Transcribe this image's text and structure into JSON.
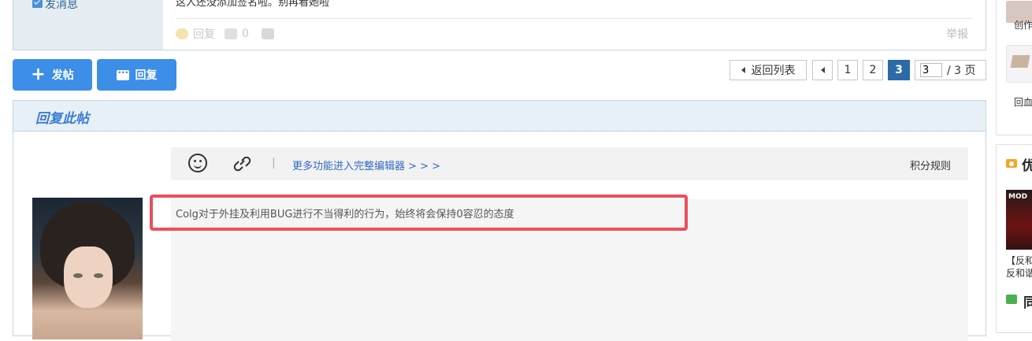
{
  "post": {
    "send_message": "发消息",
    "content": "这人还没添加签名啦。别再看她啦",
    "reply_label": "回复",
    "like_count": "0",
    "report_label": "举报"
  },
  "actions": {
    "new_post": "发帖",
    "reply": "回复"
  },
  "pagination": {
    "back_to_list": "返回列表",
    "pages": [
      "1",
      "2",
      "3"
    ],
    "current_page": "3",
    "page_input_value": "3",
    "total": "/ 3 页"
  },
  "reply_panel": {
    "title": "回复此帖",
    "full_editor_link": "更多功能进入完整编辑器 > > >",
    "points_rule": "积分规则",
    "textarea_placeholder": "Colg对于外挂及利用BUG进行不当得利的行为，始终将会保持0容忍的态度"
  },
  "sidebar": {
    "card1_label1": "创作",
    "card1_label2": "回血",
    "card2_heading": "优",
    "card2_image_text": "MOD",
    "card2_item_line1": "【反和",
    "card2_item_line2": "反和谐",
    "card2_heading2": "同"
  },
  "colors": {
    "accent": "#3c8ee8",
    "current_page": "#2c6aa8",
    "highlight": "#e9505c",
    "header_bg": "#e8f0f7"
  }
}
